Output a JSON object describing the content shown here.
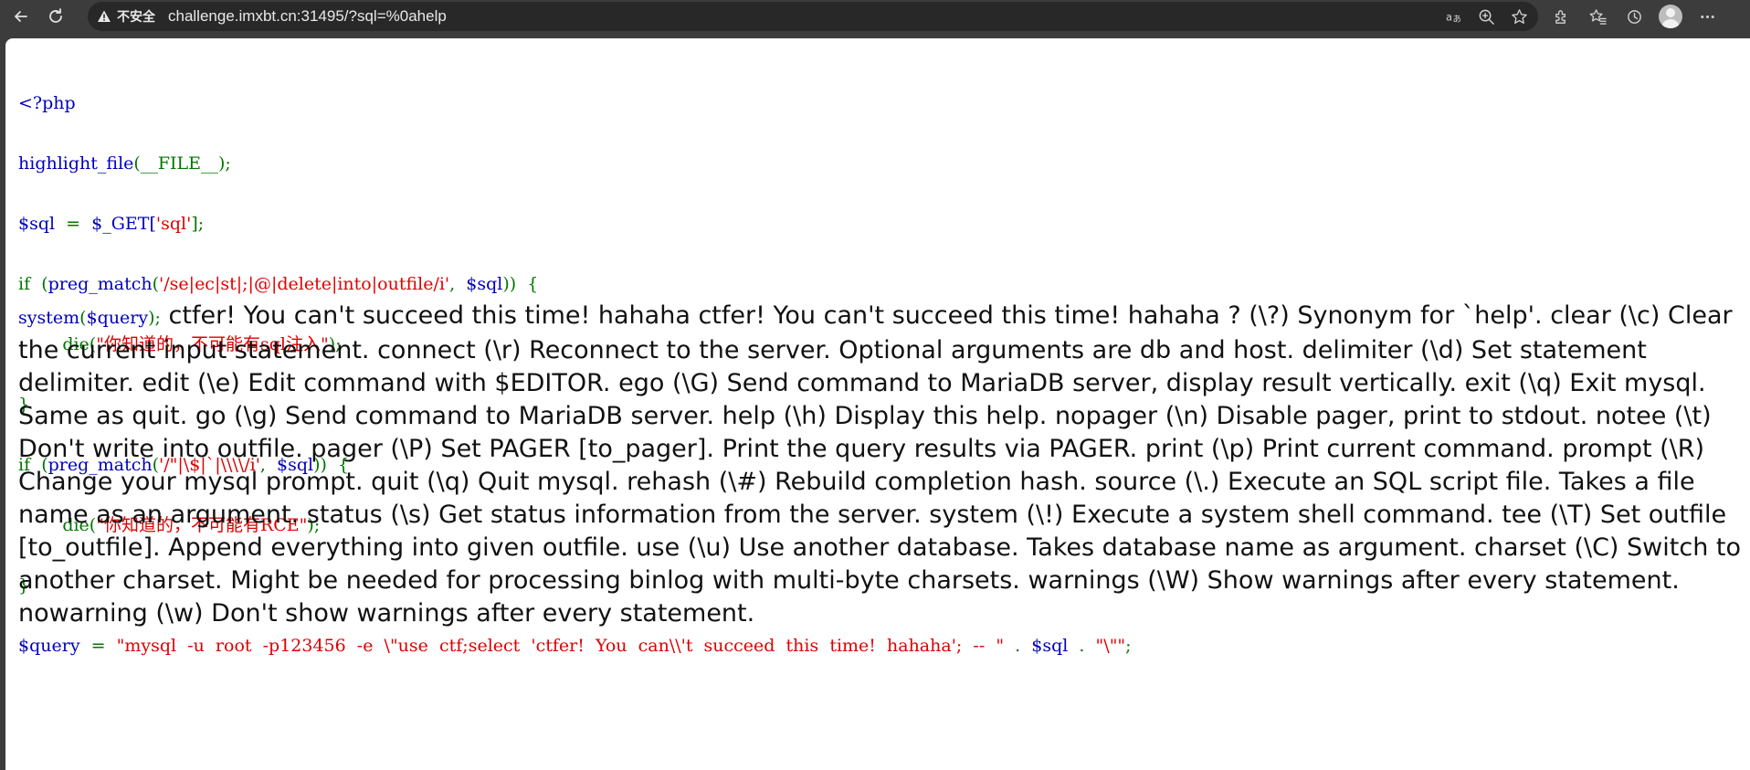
{
  "browser": {
    "security_label": "不安全",
    "url": "challenge.imxbt.cn:31495/?sql=%0ahelp"
  },
  "code": {
    "php_open": "<?php",
    "line1_fn": "highlight_file",
    "line1_rest": "(__FILE__);",
    "line2_var": "$sql",
    "line2_eq": "  =  ",
    "line2_get": "$_GET[",
    "line2_key": "'sql'",
    "line2_end": "];",
    "if1_kw": "if  (",
    "if1_fn": "preg_match",
    "if1_open": "(",
    "if1_pattern": "'/se|ec|st|;|@|delete|into|outfile/i'",
    "if1_comma": ",  ",
    "if1_var": "$sql",
    "if1_close": "))  {",
    "die1_fn": "        die(",
    "die1_msg": "\"你知道的，不可能有sql注入\"",
    "die1_end": ");",
    "close1": "}",
    "if2_kw": "if  (",
    "if2_fn": "preg_match",
    "if2_open": "(",
    "if2_pattern": "'/\"|\\$|`|\\\\\\\\/i'",
    "if2_comma": ",  ",
    "if2_var": "$sql",
    "if2_close": "))  {",
    "die2_fn": "        die(",
    "die2_msg": "\"你知道的，不可能有RCE\"",
    "die2_end": ");",
    "close2": "}",
    "query_var": "$query",
    "query_eq": "  =  ",
    "query_str": "\"mysql  -u  root  -p123456  -e  \\\"use  ctf;select  'ctfer!  You  can\\\\'t  succeed  this  time!  hahaha';  --  \"",
    "query_dot1": "  .  ",
    "query_sqlvar": "$sql",
    "query_dot2": "  .  ",
    "query_tail": "\"\\\"\"",
    "query_semi": ";",
    "system_fn": "system",
    "system_open": "(",
    "system_var": "$query",
    "system_close": ");"
  },
  "output": "ctfer! You can't succeed this time! hahaha ctfer! You can't succeed this time! hahaha ? (\\?) Synonym for `help'. clear (\\c) Clear the current input statement. connect (\\r) Reconnect to the server. Optional arguments are db and host. delimiter (\\d) Set statement delimiter. edit (\\e) Edit command with $EDITOR. ego (\\G) Send command to MariaDB server, display result vertically. exit (\\q) Exit mysql. Same as quit. go (\\g) Send command to MariaDB server. help (\\h) Display this help. nopager (\\n) Disable pager, print to stdout. notee (\\t) Don't write into outfile. pager (\\P) Set PAGER [to_pager]. Print the query results via PAGER. print (\\p) Print current command. prompt (\\R) Change your mysql prompt. quit (\\q) Quit mysql. rehash (\\#) Rebuild completion hash. source (\\.) Execute an SQL script file. Takes a file name as an argument. status (\\s) Get status information from the server. system (\\!) Execute a system shell command. tee (\\T) Set outfile [to_outfile]. Append everything into given outfile. use (\\u) Use another database. Takes database name as argument. charset (\\C) Switch to another charset. Might be needed for processing binlog with multi-byte charsets. warnings (\\W) Show warnings after every statement. nowarning (\\w) Don't show warnings after every statement."
}
